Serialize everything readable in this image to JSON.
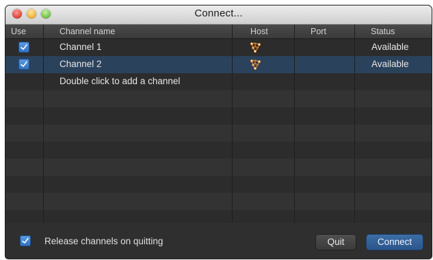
{
  "window": {
    "title": "Connect..."
  },
  "table": {
    "columns": {
      "use": "Use",
      "channel": "Channel name",
      "host": "Host",
      "port": "Port",
      "status": "Status"
    },
    "rows": [
      {
        "use": true,
        "channel": "Channel 1",
        "host_icon": "network-host-icon",
        "port": "",
        "status": "Available",
        "selected": false
      },
      {
        "use": true,
        "channel": "Channel 2",
        "host_icon": "network-host-icon",
        "port": "",
        "status": "Available",
        "selected": true
      }
    ],
    "add_hint": "Double click to add a channel"
  },
  "footer": {
    "release_checked": true,
    "release_label": "Release channels on quitting",
    "quit_label": "Quit",
    "connect_label": "Connect"
  },
  "colors": {
    "accent": "#2f6fc0",
    "selection": "#2b425c",
    "host_icon": "#e0862a"
  }
}
